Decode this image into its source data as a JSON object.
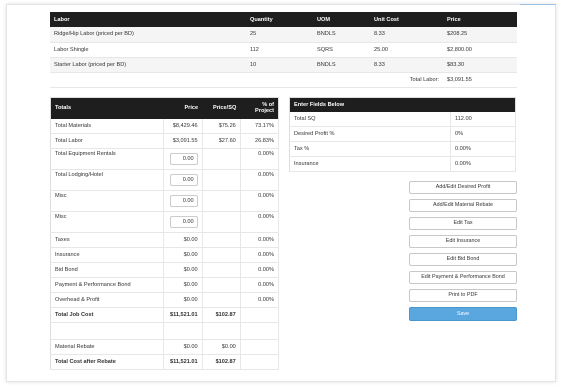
{
  "labor_table": {
    "headers": [
      "Labor",
      "Quantity",
      "UOM",
      "Unit Cost",
      "Price"
    ],
    "rows": [
      [
        "Ridge/Hip Labor (priced per BD)",
        "25",
        "BNDLS",
        "8.33",
        "$208.25"
      ],
      [
        "Labor Shingle",
        "112",
        "SQRS",
        "25.00",
        "$2,800.00"
      ],
      [
        "Starter Labor (priced per BD)",
        "10",
        "BNDLS",
        "8.33",
        "$83.30"
      ]
    ],
    "total_label": "Total Labor:",
    "total_value": "$3,091.55"
  },
  "totals_table": {
    "headers": [
      "Totals",
      "Price",
      "Price/SQ",
      "% of Project"
    ],
    "rows": [
      [
        "Total Materials",
        "$8,429.46",
        "$75.26",
        "73.17%"
      ],
      [
        "Total Labor",
        "$3,091.55",
        "$27.60",
        "26.83%"
      ],
      [
        "Total Equipment Rentals",
        "0.00",
        "",
        "0.00%"
      ],
      [
        "Total Lodging/Hotel",
        "0.00",
        "",
        "0.00%"
      ],
      [
        "Misc",
        "0.00",
        "",
        "0.00%"
      ],
      [
        "Misc",
        "0.00",
        "",
        "0.00%"
      ],
      [
        "Taxes",
        "$0.00",
        "",
        "0.00%"
      ],
      [
        "Insurance",
        "$0.00",
        "",
        "0.00%"
      ],
      [
        "Bid Bond",
        "$0.00",
        "",
        "0.00%"
      ],
      [
        "Payment & Performance Bond",
        "$0.00",
        "",
        "0.00%"
      ],
      [
        "Overhead & Profit",
        "$0.00",
        "",
        "0.00%"
      ],
      [
        "Total Job Cost",
        "$11,521.01",
        "$102.87",
        ""
      ],
      [
        "Material Rebate",
        "$0.00",
        "$0.00",
        ""
      ],
      [
        "Total Cost after Rebate",
        "$11,521.01",
        "$102.87",
        ""
      ]
    ]
  },
  "fields_table": {
    "header": "Enter Fields Below",
    "rows": [
      [
        "Total SQ",
        "112.00"
      ],
      [
        "Desired Profit %",
        "0%"
      ],
      [
        "Tax %",
        "0.00%"
      ],
      [
        "Insurance",
        "0.00%"
      ]
    ]
  },
  "buttons": {
    "add_profit": "Add/Edit Desired Profit",
    "add_rebate": "Add/Edit Material Rebate",
    "edit_tax": "Edit Tax",
    "edit_insurance": "Edit Insurance",
    "edit_bid_bond": "Edit Bid Bond",
    "edit_payment_bond": "Edit Payment & Performance Bond",
    "print_pdf": "Print to PDF",
    "save": "Save"
  },
  "colors": {
    "header_bg": "#1e1e1e",
    "save_button": "#5aa7e0"
  }
}
